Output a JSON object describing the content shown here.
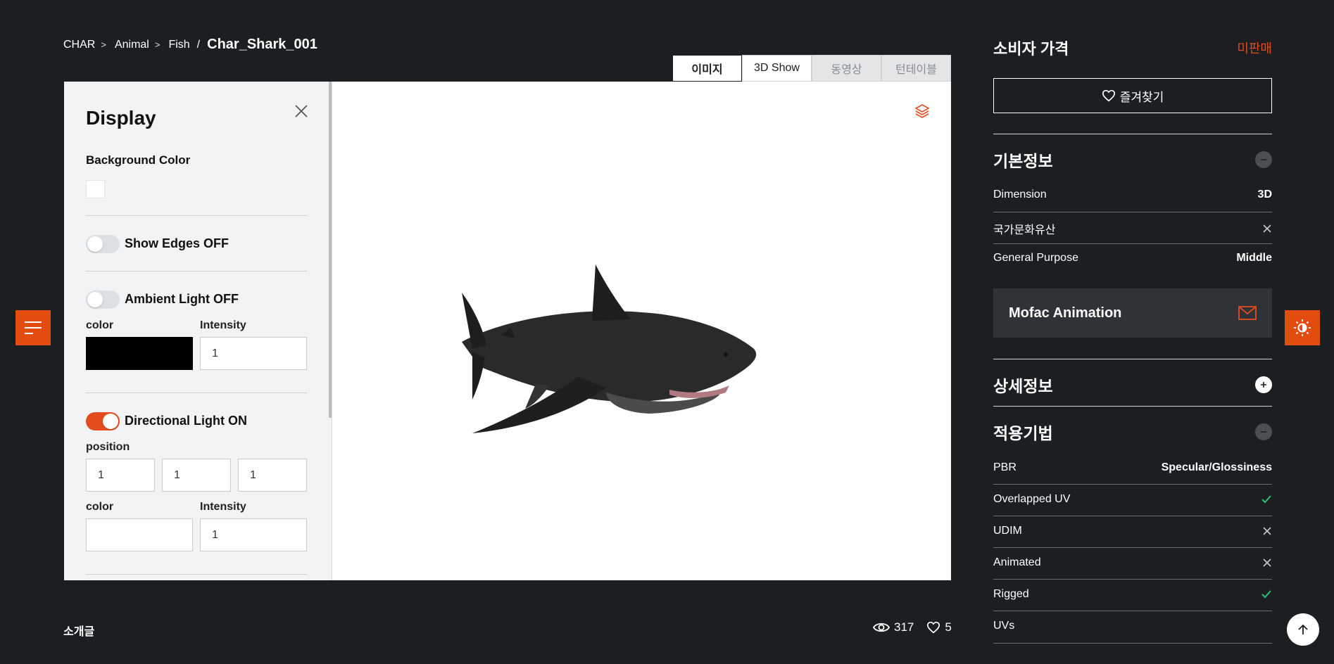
{
  "breadcrumb": {
    "items": [
      "CHAR",
      "Animal",
      "Fish"
    ],
    "current": "Char_Shark_001"
  },
  "viewer_tabs": [
    "이미지",
    "3D Show",
    "동영상",
    "턴테이블"
  ],
  "display_panel": {
    "title": "Display",
    "background_color_label": "Background Color",
    "background_color": "#ffffff",
    "show_edges": {
      "label": "Show Edges OFF",
      "on": false
    },
    "ambient_light": {
      "label": "Ambient Light OFF",
      "on": false,
      "color_label": "color",
      "color": "#000000",
      "intensity_label": "Intensity",
      "intensity": "1"
    },
    "directional_light": {
      "label": "Directional Light ON",
      "on": true,
      "position_label": "position",
      "position": [
        "1",
        "1",
        "1"
      ],
      "color_label": "color",
      "color": "#ffffff",
      "intensity_label": "Intensity",
      "intensity": "1"
    }
  },
  "bottom": {
    "intro_label": "소개글",
    "views": "317",
    "likes": "5"
  },
  "right": {
    "price_label": "소비자 가격",
    "price_status": "미판매",
    "favorite_label": "즐겨찾기",
    "basic_info": {
      "title": "기본정보",
      "rows": [
        {
          "label": "Dimension",
          "value": "3D",
          "icon": ""
        },
        {
          "label": "국가문화유산",
          "value": "",
          "icon": "x-icon"
        },
        {
          "label": "General Purpose",
          "value": "Middle",
          "icon": ""
        }
      ]
    },
    "company": "Mofac Animation",
    "detail_info": {
      "title": "상세정보"
    },
    "techniques": {
      "title": "적용기법",
      "rows": [
        {
          "label": "PBR",
          "value": "Specular/Glossiness",
          "icon": ""
        },
        {
          "label": "Overlapped UV",
          "value": "",
          "icon": "check-icon"
        },
        {
          "label": "UDIM",
          "value": "",
          "icon": "x-icon"
        },
        {
          "label": "Animated",
          "value": "",
          "icon": "x-icon"
        },
        {
          "label": "Rigged",
          "value": "",
          "icon": "check-icon"
        },
        {
          "label": "UVs",
          "value": "",
          "icon": ""
        }
      ]
    }
  },
  "colors": {
    "accent": "#e34c0f",
    "check": "#2fbf71",
    "background": "#1b1f22"
  }
}
